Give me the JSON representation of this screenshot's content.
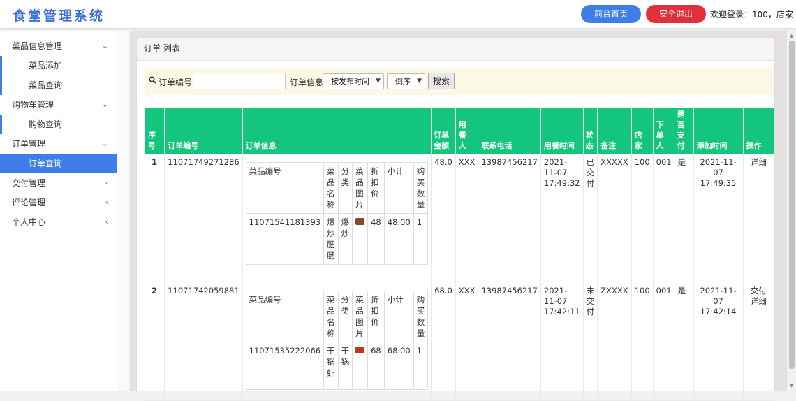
{
  "header": {
    "logo": "食堂管理系统",
    "home_button": "前台首页",
    "logout_button": "安全退出",
    "welcome": "欢迎登录：100，店家"
  },
  "sidebar": {
    "groups": [
      {
        "label": "菜品信息管理",
        "arrow": "⌄"
      },
      {
        "label": "购物车管理",
        "arrow": "⌄"
      },
      {
        "label": "订单管理",
        "arrow": "⌄"
      },
      {
        "label": "交付管理",
        "arrow": "‹"
      },
      {
        "label": "评论管理",
        "arrow": "‹"
      },
      {
        "label": "个人中心",
        "arrow": "‹"
      }
    ],
    "items": {
      "dish_add": "菜品添加",
      "dish_query": "菜品查询",
      "cart_query": "购物查询",
      "order_query": "订单查询"
    }
  },
  "card": {
    "title": "订单 列表"
  },
  "search": {
    "order_no_label": "订单编号",
    "order_no_value": "",
    "order_info_label": "订单信息",
    "sort_field": "按发布时间",
    "sort_order": "倒序",
    "search_button": "搜索"
  },
  "table": {
    "headers": {
      "seq": "序号",
      "order_no": "订单编号",
      "order_info": "订单信息",
      "amount": "订单金额",
      "diner": "用餐人",
      "phone": "联系电话",
      "meal_time": "用餐时间",
      "status": "状态",
      "remark": "备注",
      "shop": "店家",
      "orderer": "下单人",
      "paid": "是否支付",
      "added": "添加时间",
      "action": "操作"
    },
    "sub_headers": {
      "dish_no": "菜品编号",
      "dish_name": "菜品名称",
      "category": "分类",
      "image": "菜品图片",
      "discount": "折扣价",
      "subtotal": "小计",
      "qty": "购买数量"
    },
    "rows": [
      {
        "seq": "1",
        "order_no": "11071749271286",
        "amount": "48.0",
        "diner": "XXX",
        "phone": "13987456217",
        "meal_time": "2021-11-07 17:49:32",
        "status": "已交付",
        "remark": "XXXXX",
        "shop": "100",
        "orderer": "001",
        "paid": "是",
        "added": "2021-11-07 17:49:35",
        "action_pay": "",
        "action_detail": "详细",
        "item": {
          "dish_no": "11071541181393",
          "dish_name": "爆炒肥肠",
          "category": "爆炒",
          "image_color": "#8a4a1f",
          "discount": "48",
          "subtotal": "48.00",
          "qty": "1"
        }
      },
      {
        "seq": "2",
        "order_no": "11071742059881",
        "amount": "68.0",
        "diner": "XXX",
        "phone": "13987456217",
        "meal_time": "2021-11-07 17:42:11",
        "status": "未交付",
        "remark": "ZXXXX",
        "shop": "100",
        "orderer": "001",
        "paid": "是",
        "added": "2021-11-07 17:42:14",
        "action_pay": "交付",
        "action_detail": "详细",
        "item": {
          "dish_no": "11071535222066",
          "dish_name": "干锅虾",
          "category": "干锅",
          "image_color": "#b83a1a",
          "discount": "68",
          "subtotal": "68.00",
          "qty": "1"
        }
      }
    ]
  },
  "colors": {
    "primary": "#3f7ee8",
    "danger": "#e0303b",
    "table_header": "#14c57e"
  }
}
